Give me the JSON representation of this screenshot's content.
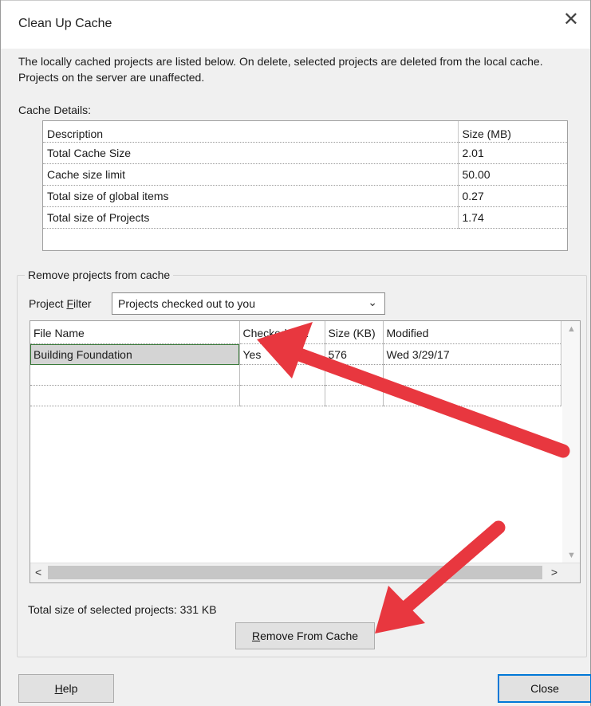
{
  "window": {
    "title": "Clean Up Cache",
    "close_glyph": "✕"
  },
  "intro_text": "The locally cached projects are listed below. On delete, selected projects are deleted from the local cache. Projects on the server are unaffected.",
  "cache_details": {
    "label": "Cache Details:",
    "headers": [
      "Description",
      "Size (MB)"
    ],
    "rows": [
      [
        "Total Cache Size",
        "2.01"
      ],
      [
        "Cache size limit",
        "50.00"
      ],
      [
        "Total size of global items",
        "0.27"
      ],
      [
        "Total size of Projects",
        "1.74"
      ]
    ]
  },
  "remove_group": {
    "legend": "Remove projects from cache",
    "filter_label_pre": "Project ",
    "filter_label_key": "F",
    "filter_label_post": "ilter",
    "filter_value": "Projects checked out to you",
    "headers": [
      "File Name",
      "Checked Out",
      "Size (KB)",
      "Modified"
    ],
    "rows": [
      [
        "Building Foundation",
        "Yes",
        "576",
        "Wed 3/29/17"
      ],
      [
        "",
        "",
        "",
        ""
      ],
      [
        "",
        "",
        "",
        ""
      ]
    ],
    "total_selected": "Total size of selected projects: 331 KB"
  },
  "buttons": {
    "remove_key": "R",
    "remove_rest": "emove From Cache",
    "help_key": "H",
    "help_rest": "elp",
    "close": "Close"
  },
  "icons": {
    "close": "close-icon",
    "dropdown": "chevron-down-icon",
    "scroll_up": "chevron-up-icon",
    "scroll_down": "chevron-down-icon",
    "scroll_left": "chevron-left-icon",
    "scroll_right": "chevron-right-icon",
    "annotation": "arrow-annotation-icon"
  },
  "colors": {
    "annotation_arrow": "#e8373f",
    "default_button_border": "#0078d7"
  }
}
